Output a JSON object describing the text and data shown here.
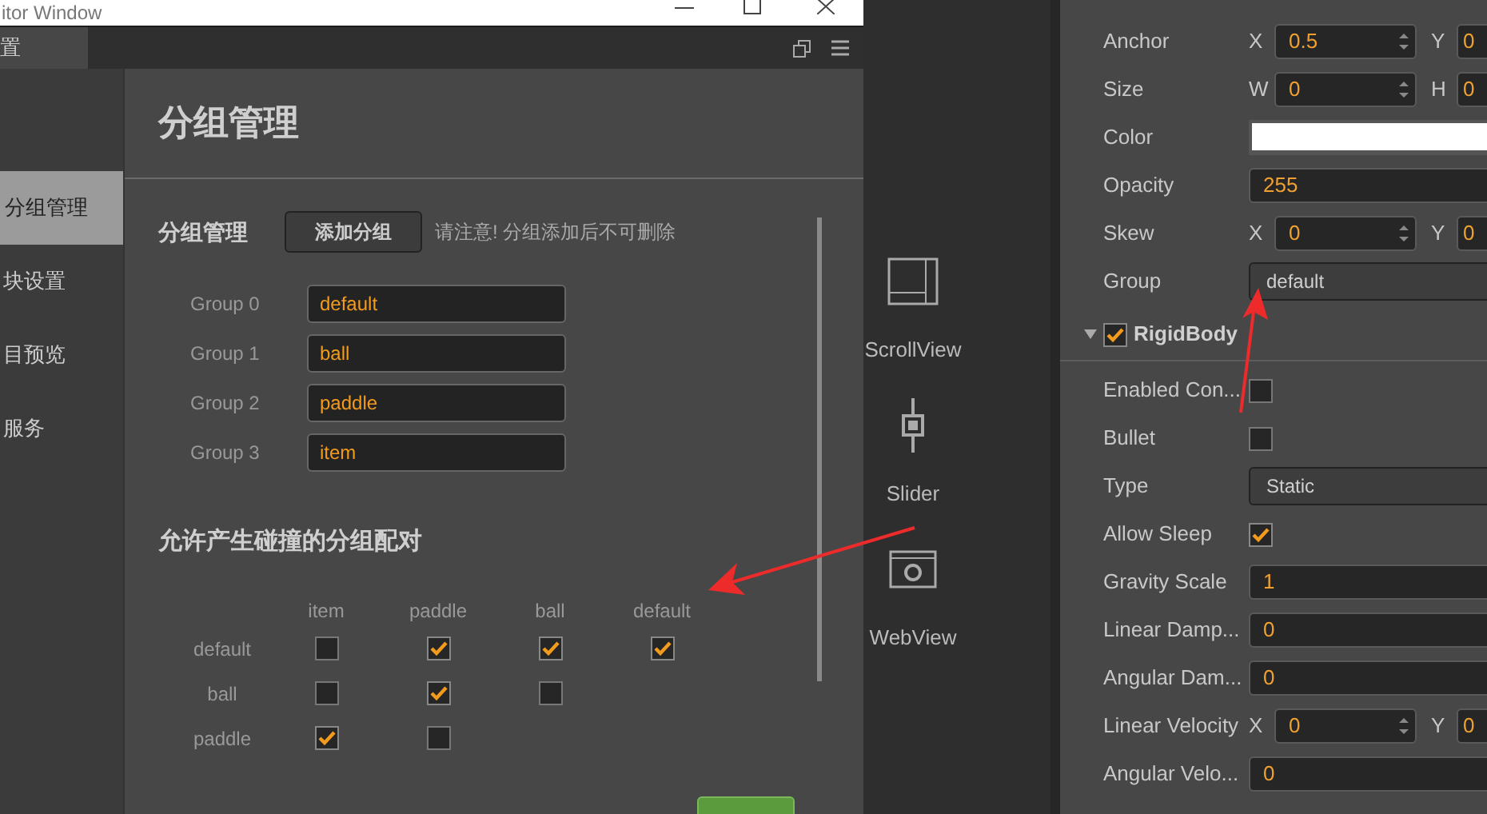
{
  "dialog": {
    "title": "itor Window",
    "tab": {
      "label": "置",
      "selected": true
    },
    "sidebar": [
      {
        "label": "分组管理",
        "selected": true
      },
      {
        "label": "块设置",
        "selected": false
      },
      {
        "label": "目预览",
        "selected": false
      },
      {
        "label": "服务",
        "selected": false
      }
    ],
    "heading": "分组管理",
    "group_section": {
      "title": "分组管理",
      "add_button": "添加分组",
      "note": "请注意! 分组添加后不可删除",
      "groups": [
        {
          "label": "Group 0",
          "value": "default"
        },
        {
          "label": "Group 1",
          "value": "ball"
        },
        {
          "label": "Group 2",
          "value": "paddle"
        },
        {
          "label": "Group 3",
          "value": "item"
        }
      ]
    },
    "collision_section": {
      "title": "允许产生碰撞的分组配对",
      "columns": [
        "item",
        "paddle",
        "ball",
        "default"
      ],
      "rows": [
        {
          "label": "default",
          "cells": [
            {
              "checked": false
            },
            {
              "checked": true
            },
            {
              "checked": true
            },
            {
              "checked": true
            }
          ]
        },
        {
          "label": "ball",
          "cells": [
            {
              "checked": false
            },
            {
              "checked": true
            },
            {
              "checked": false
            }
          ]
        },
        {
          "label": "paddle",
          "cells": [
            {
              "checked": true
            },
            {
              "checked": false
            }
          ]
        }
      ]
    }
  },
  "palette": [
    {
      "kind": "scrollview",
      "label": "ScrollView"
    },
    {
      "kind": "slider",
      "label": "Slider"
    },
    {
      "kind": "webview",
      "label": "WebView"
    }
  ],
  "inspector": [
    {
      "kind": "xy",
      "label": "Anchor",
      "fields": [
        {
          "axis": "X",
          "value": "0.5"
        },
        {
          "axis": "Y",
          "value": "0"
        }
      ]
    },
    {
      "kind": "xy",
      "label": "Size",
      "fields": [
        {
          "axis": "W",
          "value": "0"
        },
        {
          "axis": "H",
          "value": "0"
        }
      ]
    },
    {
      "kind": "color",
      "label": "Color"
    },
    {
      "kind": "field",
      "label": "Opacity",
      "value": "255"
    },
    {
      "kind": "xy",
      "label": "Skew",
      "fields": [
        {
          "axis": "X",
          "value": "0"
        },
        {
          "axis": "Y",
          "value": "0"
        }
      ]
    },
    {
      "kind": "dropdown",
      "label": "Group",
      "value": "default"
    },
    {
      "kind": "component",
      "label": "RigidBody",
      "checked": true,
      "expanded": true
    },
    {
      "kind": "checkbox",
      "label": "Enabled Con...",
      "checked": false
    },
    {
      "kind": "checkbox",
      "label": "Bullet",
      "checked": false
    },
    {
      "kind": "dropdown",
      "label": "Type",
      "value": "Static"
    },
    {
      "kind": "checkbox",
      "label": "Allow Sleep",
      "checked": true
    },
    {
      "kind": "field",
      "label": "Gravity Scale",
      "value": "1"
    },
    {
      "kind": "field",
      "label": "Linear Damp...",
      "value": "0"
    },
    {
      "kind": "field",
      "label": "Angular Dam...",
      "value": "0"
    },
    {
      "kind": "xy",
      "label": "Linear Velocity",
      "fields": [
        {
          "axis": "X",
          "value": "0"
        },
        {
          "axis": "Y",
          "value": "0"
        }
      ]
    },
    {
      "kind": "field",
      "label": "Angular Velo...",
      "value": "0"
    }
  ]
}
